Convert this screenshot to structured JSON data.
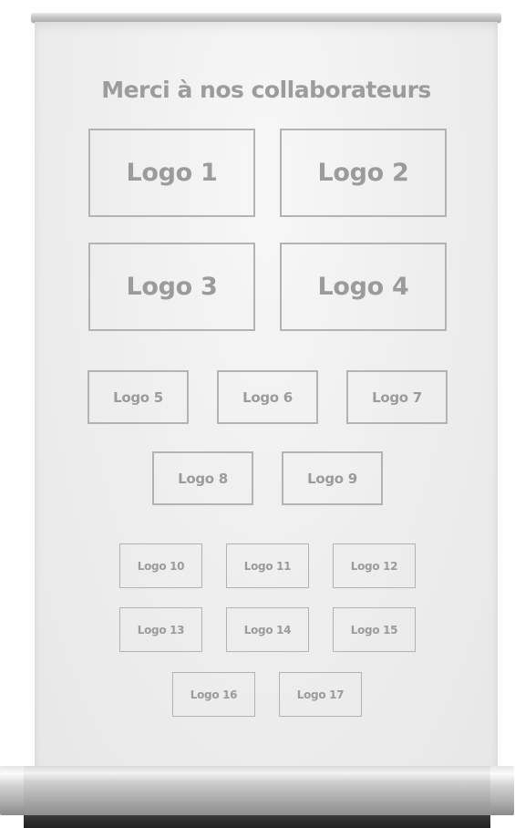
{
  "banner": {
    "title": "Merci à nos collaborateurs"
  },
  "logos": {
    "big": [
      "Logo 1",
      "Logo 2",
      "Logo 3",
      "Logo 4"
    ],
    "mid": [
      "Logo 5",
      "Logo 6",
      "Logo 7",
      "Logo 8",
      "Logo 9"
    ],
    "small": [
      "Logo 10",
      "Logo 11",
      "Logo 12",
      "Logo 13",
      "Logo 14",
      "Logo 15",
      "Logo 16",
      "Logo 17"
    ]
  },
  "colors": {
    "banner_background": "#efefef",
    "text": "#9b9b9b",
    "logo_border": "#b3b3b3",
    "base_metal": "#b8b8b8",
    "base_foot": "#2b2b2b"
  }
}
